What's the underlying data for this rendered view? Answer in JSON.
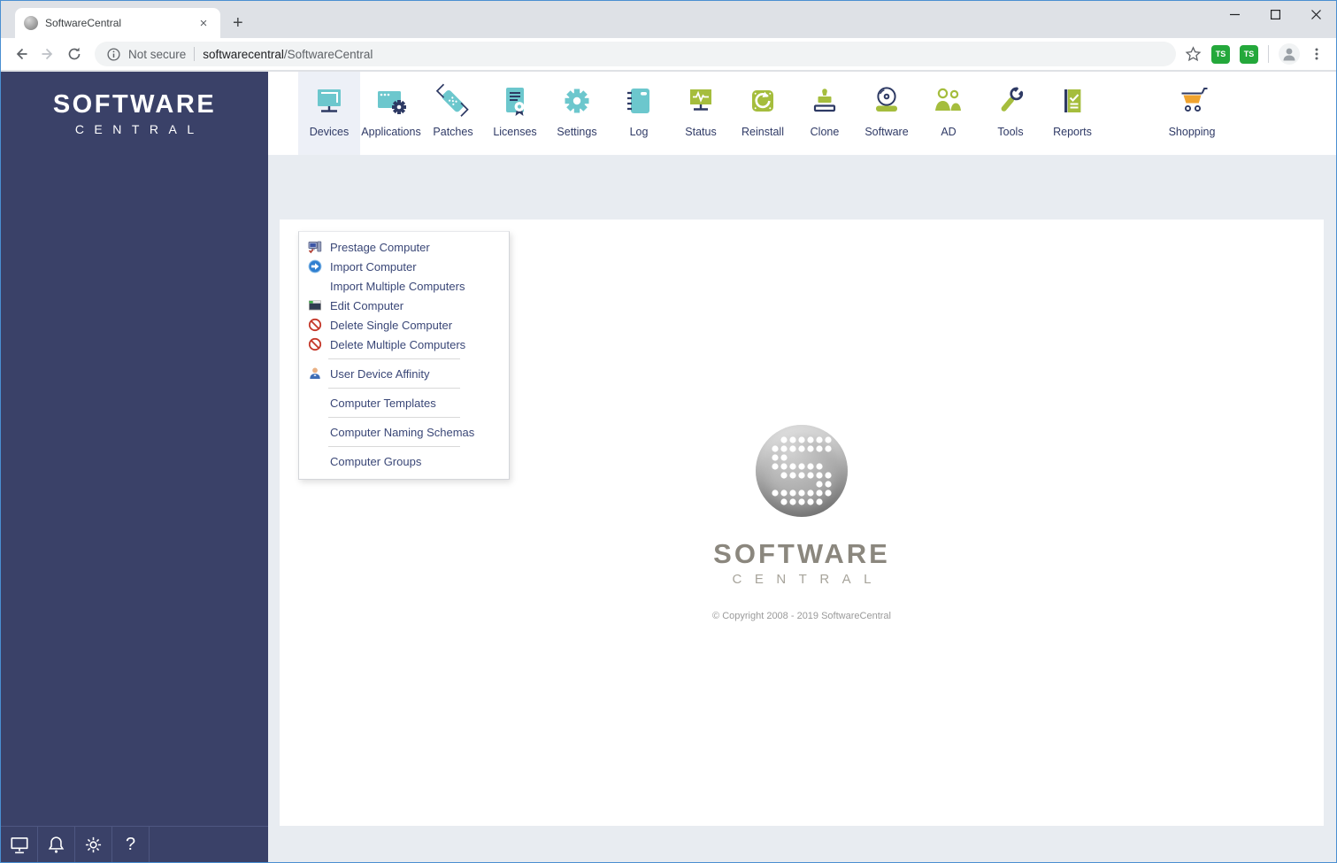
{
  "browser": {
    "tab": {
      "title": "SoftwareCentral",
      "close_glyph": "×"
    },
    "new_tab_glyph": "+",
    "address": {
      "security": "Not secure",
      "url_host": "softwarecentral",
      "url_path": "/SoftwareCentral"
    },
    "extensions": [
      {
        "label": "TS"
      },
      {
        "label": "TS"
      }
    ]
  },
  "sidebar": {
    "logo_top": "SOFTWARE",
    "logo_bottom": "CENTRAL",
    "footer_icons": [
      "computer-icon",
      "bell-icon",
      "gear-icon",
      "help-icon"
    ]
  },
  "menu": {
    "items": [
      {
        "label": "Devices",
        "icon": "devices-icon",
        "active": true
      },
      {
        "label": "Applications",
        "icon": "applications-icon"
      },
      {
        "label": "Patches",
        "icon": "patches-icon"
      },
      {
        "label": "Licenses",
        "icon": "licenses-icon"
      },
      {
        "label": "Settings",
        "icon": "settings-icon"
      },
      {
        "label": "Log",
        "icon": "log-icon"
      },
      {
        "label": "Status",
        "icon": "status-icon"
      },
      {
        "label": "Reinstall",
        "icon": "reinstall-icon"
      },
      {
        "label": "Clone",
        "icon": "clone-icon"
      },
      {
        "label": "Software",
        "icon": "software-icon"
      },
      {
        "label": "AD",
        "icon": "ad-icon"
      },
      {
        "label": "Tools",
        "icon": "tools-icon"
      },
      {
        "label": "Reports",
        "icon": "reports-icon"
      },
      {
        "label": "Shopping",
        "icon": "shopping-icon",
        "spacer_before": true
      }
    ]
  },
  "dropdown": {
    "items": [
      {
        "label": "Prestage Computer",
        "icon": "prestage-computer-icon"
      },
      {
        "label": "Import Computer",
        "icon": "import-computer-icon"
      },
      {
        "label": "Import Multiple Computers"
      },
      {
        "label": "Edit Computer",
        "icon": "edit-computer-icon"
      },
      {
        "label": "Delete Single Computer",
        "icon": "delete-icon"
      },
      {
        "label": "Delete Multiple Computers",
        "icon": "delete-icon"
      },
      {
        "divider": true
      },
      {
        "label": "User Device Affinity",
        "icon": "user-device-icon"
      },
      {
        "divider": true
      },
      {
        "label": "Computer Templates"
      },
      {
        "divider": true
      },
      {
        "label": "Computer Naming Schemas"
      },
      {
        "divider": true
      },
      {
        "label": "Computer Groups"
      }
    ]
  },
  "content": {
    "logo_top": "SOFTWARE",
    "logo_bottom": "CENTRAL",
    "copyright": "© Copyright 2008 - 2019 SoftwareCentral",
    "logo_dot_pattern": [
      ".111111",
      "1111111",
      "11.....",
      "111111.",
      ".111111",
      ".....11",
      "1111111",
      ".11111."
    ]
  },
  "colors": {
    "sidebar_navy": "#3a4168",
    "icon_teal": "#6cc7cd",
    "icon_navy": "#2e3a64",
    "icon_olive": "#a5bd3d",
    "icon_orange": "#f0a32e",
    "delete_red": "#c5392b",
    "band_gray": "#e8ecf1",
    "active_highlight": "#edf0f7"
  }
}
